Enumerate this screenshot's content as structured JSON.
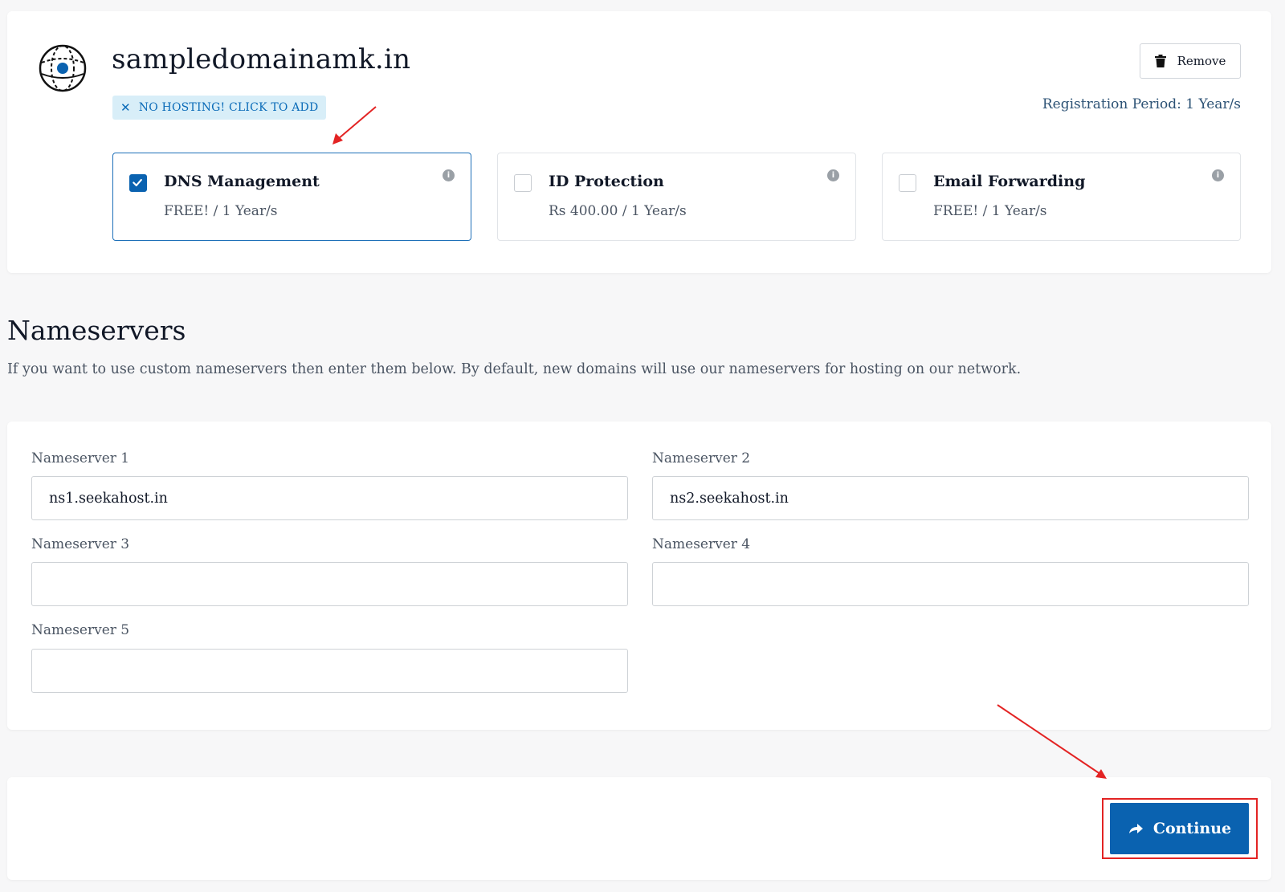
{
  "domain": {
    "name": "sampledomainamk.in",
    "hosting_badge": "NO HOSTING! CLICK TO ADD",
    "remove_label": "Remove",
    "registration_period": "Registration Period: 1 Year/s"
  },
  "addons": [
    {
      "name": "DNS Management",
      "price": "FREE! / 1 Year/s",
      "checked": true
    },
    {
      "name": "ID Protection",
      "price": "Rs 400.00 / 1 Year/s",
      "checked": false
    },
    {
      "name": "Email Forwarding",
      "price": "FREE! / 1 Year/s",
      "checked": false
    }
  ],
  "nameservers": {
    "heading": "Nameservers",
    "description": "If you want to use custom nameservers then enter them below. By default, new domains will use our nameservers for hosting on our network.",
    "fields": [
      {
        "label": "Nameserver 1",
        "value": "ns1.seekahost.in"
      },
      {
        "label": "Nameserver 2",
        "value": "ns2.seekahost.in"
      },
      {
        "label": "Nameserver 3",
        "value": ""
      },
      {
        "label": "Nameserver 4",
        "value": ""
      },
      {
        "label": "Nameserver 5",
        "value": ""
      }
    ]
  },
  "footer": {
    "continue_label": "Continue"
  },
  "colors": {
    "primary": "#0a62b0",
    "badge_bg": "#d8eef8",
    "annotation": "#e32323"
  },
  "icons": [
    "globe-icon",
    "close-icon",
    "trash-icon",
    "check-icon",
    "info-icon",
    "arrow-right-icon"
  ]
}
